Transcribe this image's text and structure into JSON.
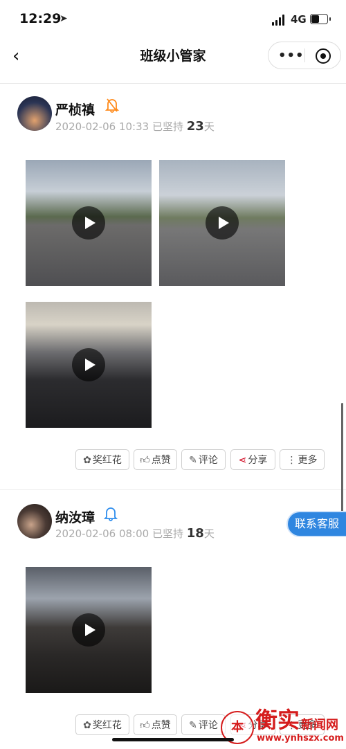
{
  "status_bar": {
    "time": "12:29",
    "location_glyph": "➤",
    "network": "4G"
  },
  "nav": {
    "back_glyph": "‹",
    "title": "班级小管家",
    "more_glyph": "•••"
  },
  "posts": [
    {
      "name": "严桢禛",
      "bell": "notify-off",
      "date": "2020-02-06 10:33",
      "streak_prefix": "已坚持",
      "streak_days": "23",
      "streak_unit": "天",
      "videos": 3
    },
    {
      "name": "纳汝璋",
      "bell": "notify-on",
      "date": "2020-02-06 08:00",
      "streak_prefix": "已坚持",
      "streak_days": "18",
      "streak_unit": "天",
      "videos": 1
    }
  ],
  "actions": {
    "award": "奖红花",
    "like": "点赞",
    "comment": "评论",
    "share": "分享",
    "more": "更多"
  },
  "service_button": "联系客服",
  "watermark": {
    "seal": "本",
    "brand": "衡实",
    "site": "新闻网",
    "url": "www.ynhszx.com"
  },
  "colors": {
    "accent_blue": "#2f86e0",
    "bell_orange": "#ff8a1a",
    "share_red": "#d0021b"
  }
}
